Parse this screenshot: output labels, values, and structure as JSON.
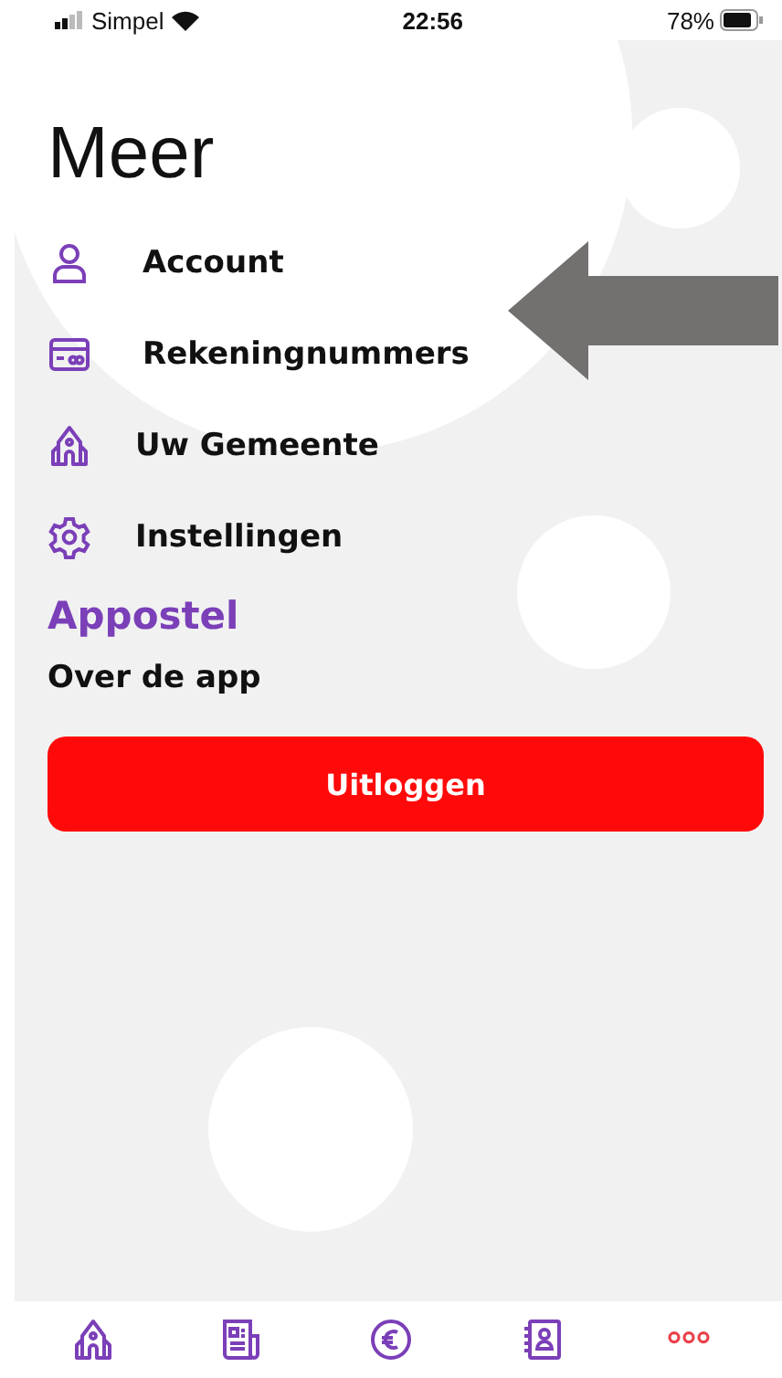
{
  "status_bar": {
    "carrier": "Simpel",
    "time": "22:56",
    "battery": "78%"
  },
  "title": "Meer",
  "menu": [
    {
      "kind": "person",
      "label": "Account"
    },
    {
      "kind": "card",
      "label": "Rekeningnummers"
    },
    {
      "kind": "building",
      "label": "Uw Gemeente"
    },
    {
      "kind": "gear",
      "label": "Instellingen"
    }
  ],
  "section": {
    "title": "Appostel",
    "items": [
      "Over de app"
    ]
  },
  "logout_button": "Uitloggen",
  "tabs": [
    {
      "kind": "building",
      "selected": false
    },
    {
      "kind": "news",
      "selected": false
    },
    {
      "kind": "euro",
      "selected": false
    },
    {
      "kind": "contacts",
      "selected": false
    },
    {
      "kind": "more",
      "selected": true
    }
  ]
}
